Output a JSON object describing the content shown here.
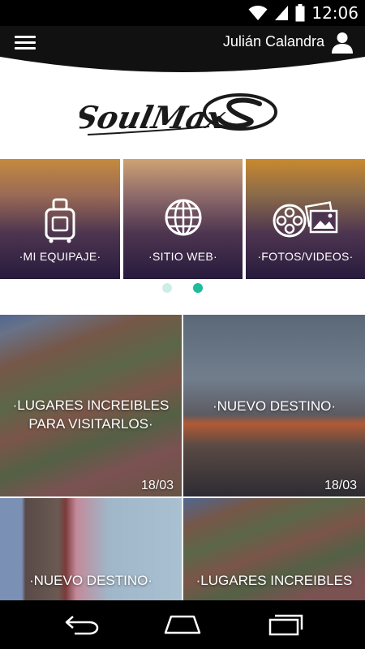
{
  "status_bar": {
    "time": "12:06",
    "icons": [
      "wifi-icon",
      "cellular-signal-icon",
      "battery-icon"
    ]
  },
  "header": {
    "menu_icon": "hamburger-menu-icon",
    "user_name": "Julián Calandra",
    "user_icon": "user-account-icon"
  },
  "logo": {
    "text": "SoulMax"
  },
  "quick_links": [
    {
      "label": "·MI EQUIPAJE·",
      "icon": "luggage-icon"
    },
    {
      "label": "·SITIO WEB·",
      "icon": "globe-icon"
    },
    {
      "label": "·FOTOS/VIDEOS·",
      "icon": "photos-videos-icon"
    }
  ],
  "carousel": {
    "page_count": 2,
    "active_page": 2
  },
  "news": [
    {
      "title_line1": "·LUGARES INCREIBLES",
      "title_line2": "PARA VISITARLOS·",
      "date": "18/03"
    },
    {
      "title_line1": "·NUEVO DESTINO·",
      "title_line2": "",
      "date": "18/03"
    },
    {
      "title_line1": "·NUEVO DESTINO·",
      "title_line2": "",
      "date": ""
    },
    {
      "title_line1": "·LUGARES INCREIBLES",
      "title_line2": "",
      "date": ""
    }
  ],
  "nav_bar": {
    "buttons": [
      "back-icon",
      "home-icon",
      "recent-apps-icon"
    ]
  },
  "colors": {
    "header_bg": "#111111",
    "accent_teal": "#1ebc9b",
    "dot_inactive": "#cdeee6",
    "tile_overlay_orange": "#c9822e",
    "tile_overlay_purple": "#2b1d44"
  }
}
